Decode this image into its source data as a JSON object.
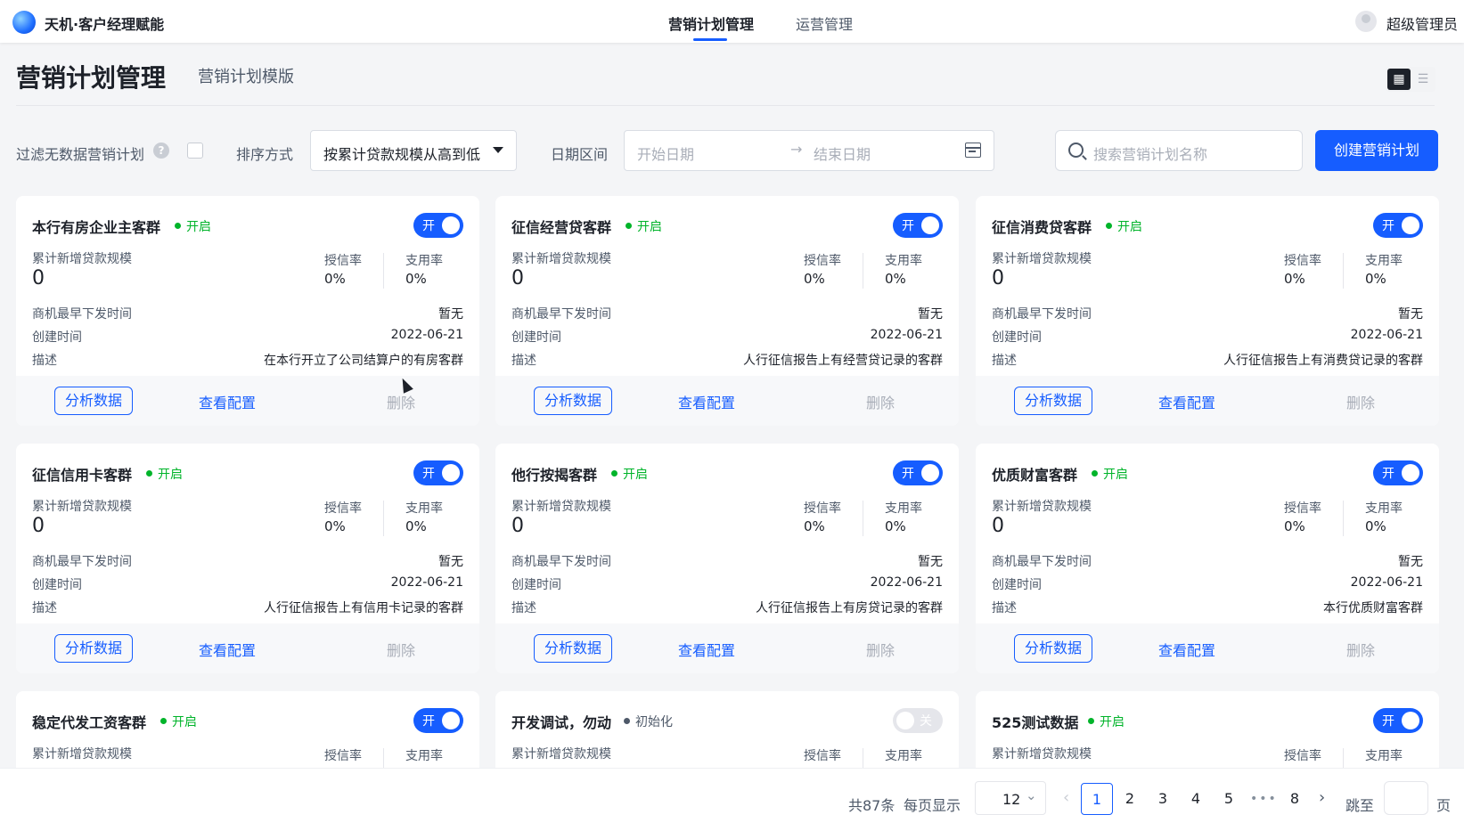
{
  "topbar": {
    "app_name": "天机·客户经理赋能",
    "tabs": [
      {
        "label": "营销计划管理",
        "active": true
      },
      {
        "label": "运营管理",
        "active": false
      }
    ],
    "user": "超级管理员"
  },
  "header": {
    "title": "营销计划管理",
    "subtitle": "营销计划模版",
    "view_icons": [
      "grid-view-icon",
      "list-view-icon"
    ]
  },
  "filters": {
    "filter_empty_label": "过滤无数据营销计划",
    "sort_label": "排序方式",
    "sort_value": "按累计贷款规模从高到低",
    "date_label": "日期区间",
    "date_start_placeholder": "开始日期",
    "date_arrow": "→",
    "date_end_placeholder": "结束日期",
    "search_placeholder": "搜索营销计划名称",
    "create_button": "创建营销计划"
  },
  "card_labels": {
    "loan_scale": "累计新增贷款规模",
    "credit_rate": "授信率",
    "usage_rate": "支用率",
    "earliest_time": "商机最早下发时间",
    "created_time": "创建时间",
    "description": "描述",
    "analyze_button": "分析数据",
    "config_button": "查看配置",
    "delete_button": "删除"
  },
  "cards": [
    {
      "name": "本行有房企业主客群",
      "status": "开启",
      "switch": "开",
      "switch_on": true,
      "loan": "0",
      "credit": "0%",
      "usage": "0%",
      "earliest": "暂无",
      "created": "2022-06-21",
      "desc": "在本行开立了公司结算户的有房客群"
    },
    {
      "name": "征信经营贷客群",
      "status": "开启",
      "switch": "开",
      "switch_on": true,
      "loan": "0",
      "credit": "0%",
      "usage": "0%",
      "earliest": "暂无",
      "created": "2022-06-21",
      "desc": "人行征信报告上有经营贷记录的客群"
    },
    {
      "name": "征信消费贷客群",
      "status": "开启",
      "switch": "开",
      "switch_on": true,
      "loan": "0",
      "credit": "0%",
      "usage": "0%",
      "earliest": "暂无",
      "created": "2022-06-21",
      "desc": "人行征信报告上有消费贷记录的客群"
    },
    {
      "name": "征信信用卡客群",
      "status": "开启",
      "switch": "开",
      "switch_on": true,
      "loan": "0",
      "credit": "0%",
      "usage": "0%",
      "earliest": "暂无",
      "created": "2022-06-21",
      "desc": "人行征信报告上有信用卡记录的客群"
    },
    {
      "name": "他行按揭客群",
      "status": "开启",
      "switch": "开",
      "switch_on": true,
      "loan": "0",
      "credit": "0%",
      "usage": "0%",
      "earliest": "暂无",
      "created": "2022-06-21",
      "desc": "人行征信报告上有房贷记录的客群"
    },
    {
      "name": "优质财富客群",
      "status": "开启",
      "switch": "开",
      "switch_on": true,
      "loan": "0",
      "credit": "0%",
      "usage": "0%",
      "earliest": "暂无",
      "created": "2022-06-21",
      "desc": "本行优质财富客群"
    },
    {
      "name": "稳定代发工资客群",
      "status": "开启",
      "switch": "开",
      "switch_on": true
    },
    {
      "name": "开发调试，勿动",
      "status": "初始化",
      "switch": "关",
      "switch_on": false
    },
    {
      "name": "525测试数据",
      "status": "开启",
      "switch": "开",
      "switch_on": true
    }
  ],
  "pagination": {
    "total": "共87条",
    "per_page_label": "每页显示",
    "per_page_value": "12",
    "pages": [
      "1",
      "2",
      "3",
      "4",
      "5",
      "8"
    ],
    "current": "1",
    "ellipsis": "•••",
    "jump_label": "跳至",
    "page_suffix": "页"
  }
}
